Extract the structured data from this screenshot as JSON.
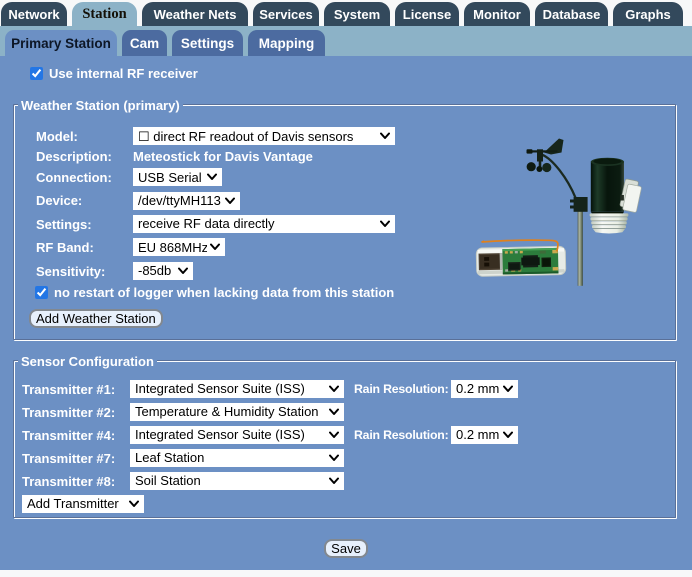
{
  "colors": {
    "page_background": "#f7f8f9",
    "content_background": "#6c90c4",
    "top_tab": "#33495c",
    "top_tab_selected": "#8fb4c9",
    "sub_tab": "#4c6ba0",
    "sub_tab_selected": "#6c90c4",
    "label_text": "#ffffff",
    "checkbox_accent": "#2376e5"
  },
  "top_tabs": {
    "selected": "Station",
    "items": [
      {
        "label": "Network"
      },
      {
        "label": "Station"
      },
      {
        "label": "Weather Nets"
      },
      {
        "label": "Services"
      },
      {
        "label": "System"
      },
      {
        "label": "License"
      },
      {
        "label": "Monitor"
      },
      {
        "label": "Database"
      },
      {
        "label": "Graphs"
      }
    ]
  },
  "sub_tabs": {
    "selected": "Primary Station",
    "items": [
      {
        "label": "Primary Station"
      },
      {
        "label": "Cam"
      },
      {
        "label": "Settings"
      },
      {
        "label": "Mapping"
      }
    ]
  },
  "station_page": {
    "use_internal_rf": {
      "label": "Use internal RF receiver",
      "checked": true
    },
    "weather_station": {
      "legend": "Weather Station (primary)",
      "model": {
        "label": "Model:",
        "value": "☐ direct RF readout of Davis sensors"
      },
      "description": {
        "label": "Description:",
        "value": "Meteostick for Davis Vantage"
      },
      "connection": {
        "label": "Connection:",
        "value": "USB Serial"
      },
      "device": {
        "label": "Device:",
        "value": "/dev/ttyMH113"
      },
      "settings": {
        "label": "Settings:",
        "value": "receive RF data directly"
      },
      "rf_band": {
        "label": "RF Band:",
        "value": "EU 868MHz"
      },
      "sensitivity": {
        "label": "Sensitivity:",
        "value": "-85db"
      },
      "no_restart": {
        "label": "no restart of logger when lacking data from this station",
        "checked": true
      },
      "add_button": "Add Weather Station",
      "device_image": "davis-vantage-iss-and-meteostick-usb-receiver"
    },
    "sensor_configuration": {
      "legend": "Sensor Configuration",
      "transmitters": [
        {
          "label": "Transmitter #1:",
          "value": "Integrated Sensor Suite (ISS)",
          "rain_label": "Rain Resolution:",
          "rain_value": "0.2 mm"
        },
        {
          "label": "Transmitter #2:",
          "value": "Temperature & Humidity Station"
        },
        {
          "label": "Transmitter #4:",
          "value": "Integrated Sensor Suite (ISS)",
          "rain_label": "Rain Resolution:",
          "rain_value": "0.2 mm"
        },
        {
          "label": "Transmitter #7:",
          "value": "Leaf Station"
        },
        {
          "label": "Transmitter #8:",
          "value": "Soil Station"
        }
      ],
      "add_transmitter": "Add Transmitter"
    },
    "save_button": "Save"
  }
}
